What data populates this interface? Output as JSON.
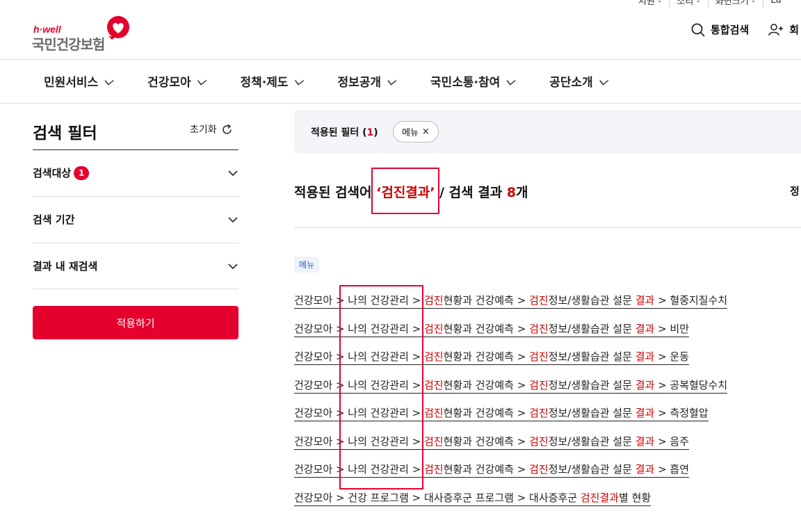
{
  "utility": [
    "지원",
    "소리",
    "화면크기",
    "La"
  ],
  "logo": {
    "tagline": "h·well",
    "name": "국민건강보험"
  },
  "header": {
    "search": "통합검색",
    "member": "회"
  },
  "nav": [
    "민원서비스",
    "건강모아",
    "정책·제도",
    "정보공개",
    "국민소통·참여",
    "공단소개"
  ],
  "filter": {
    "title": "검색 필터",
    "reset": "초기화",
    "sections": [
      {
        "label": "검색대상",
        "badge": "1"
      },
      {
        "label": "검색 기간"
      },
      {
        "label": "결과 내 재검색"
      }
    ],
    "apply": "적용하기"
  },
  "applied": {
    "label": "적용된 필터 (",
    "count": "1",
    "close": ")",
    "chip": "메뉴",
    "chip_x": "×"
  },
  "result_head": {
    "prefix": "적용된 검색어 ",
    "keyword": "‘검진결과’",
    "middle": " / 검색 결과 ",
    "count": "8",
    "suffix": "개",
    "right": "정"
  },
  "category_tag": "메뉴",
  "results": [
    {
      "pre": "건강모아 > 나의 건강관리 > ",
      "hl1": "검진",
      "mid": "현황과 건강예측 > ",
      "hl2": "검진",
      "mid2": "정보/생활습관 설문 ",
      "hl3": "결과",
      "post": " > 혈중지질수치"
    },
    {
      "pre": "건강모아 > 나의 건강관리 > ",
      "hl1": "검진",
      "mid": "현황과 건강예측 > ",
      "hl2": "검진",
      "mid2": "정보/생활습관 설문 ",
      "hl3": "결과",
      "post": " > 비만"
    },
    {
      "pre": "건강모아 > 나의 건강관리 > ",
      "hl1": "검진",
      "mid": "현황과 건강예측 > ",
      "hl2": "검진",
      "mid2": "정보/생활습관 설문 ",
      "hl3": "결과",
      "post": " > 운동"
    },
    {
      "pre": "건강모아 > 나의 건강관리 > ",
      "hl1": "검진",
      "mid": "현황과 건강예측 > ",
      "hl2": "검진",
      "mid2": "정보/생활습관 설문 ",
      "hl3": "결과",
      "post": " > 공복혈당수치"
    },
    {
      "pre": "건강모아 > 나의 건강관리 > ",
      "hl1": "검진",
      "mid": "현황과 건강예측 > ",
      "hl2": "검진",
      "mid2": "정보/생활습관 설문 ",
      "hl3": "결과",
      "post": " > 측정혈압"
    },
    {
      "pre": "건강모아 > 나의 건강관리 > ",
      "hl1": "검진",
      "mid": "현황과 건강예측 > ",
      "hl2": "검진",
      "mid2": "정보/생활습관 설문 ",
      "hl3": "결과",
      "post": " > 음주"
    },
    {
      "pre": "건강모아 > 나의 건강관리 > ",
      "hl1": "검진",
      "mid": "현황과 건강예측 > ",
      "hl2": "검진",
      "mid2": "정보/생활습관 설문 ",
      "hl3": "결과",
      "post": " > 흡연"
    },
    {
      "pre": "건강모아 > 건강 프로그램 > 대사증후군 프로그램 > 대사증후군 ",
      "hl1": "검진결과",
      "mid": "별 현황",
      "hl2": "",
      "mid2": "",
      "hl3": "",
      "post": ""
    }
  ],
  "colors": {
    "accent": "#e6002d",
    "highlight": "#cc0000",
    "panel": "#f3f5f9"
  }
}
